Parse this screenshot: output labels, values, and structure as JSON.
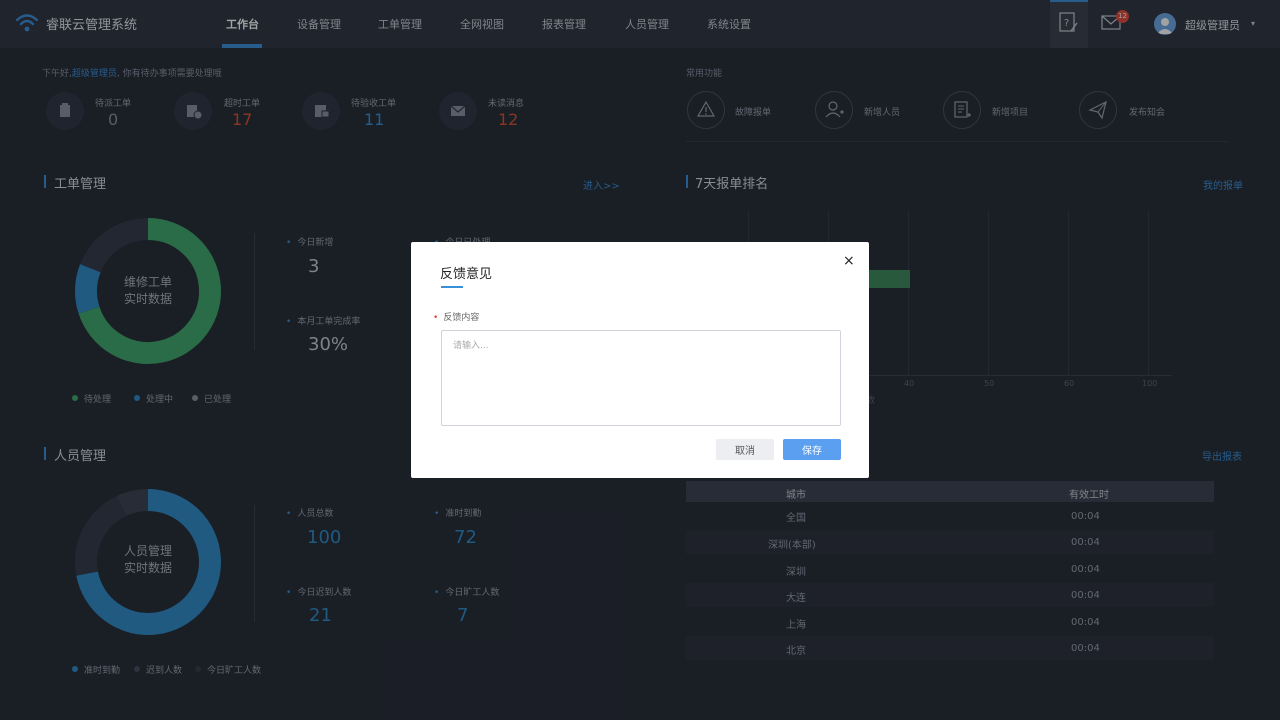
{
  "header": {
    "app_title": "睿联云管理系统",
    "nav": [
      "工作台",
      "设备管理",
      "工单管理",
      "全网视图",
      "报表管理",
      "人员管理",
      "系统设置"
    ],
    "active_nav": "工作台",
    "mail_badge": "12",
    "user_name": "超级管理员",
    "user_caret": "▾"
  },
  "greeting": {
    "prefix": "下午好,",
    "user": "超级管理员",
    "suffix": ", 你有待办事项需要处理哦"
  },
  "stats": [
    {
      "label": "待派工单",
      "value": "0",
      "color": "#9aa0ae",
      "icon": "clipboard-icon"
    },
    {
      "label": "超时工单",
      "value": "17",
      "color": "#d9532c",
      "icon": "overdue-icon"
    },
    {
      "label": "待验收工单",
      "value": "11",
      "color": "#3a8fd9",
      "icon": "inbox-icon"
    },
    {
      "label": "未读消息",
      "value": "12",
      "color": "#d9532c",
      "icon": "envelope-icon"
    }
  ],
  "common": {
    "title": "常用功能",
    "items": [
      {
        "label": "故障报单",
        "icon": "warning-icon"
      },
      {
        "label": "新增人员",
        "icon": "add-user-icon"
      },
      {
        "label": "新增项目",
        "icon": "add-project-icon"
      },
      {
        "label": "发布知会",
        "icon": "send-icon"
      }
    ]
  },
  "work_orders": {
    "title": "工单管理",
    "link": "进入>>",
    "donut_center": [
      "维修工单",
      "实时数据"
    ],
    "kpis": [
      {
        "label": "今日新增",
        "value": "3"
      },
      {
        "label": "今日已处理",
        "value": ""
      },
      {
        "label": "本月工单完成率",
        "value": "30%"
      }
    ],
    "legend": [
      {
        "label": "待处理",
        "color": "#3ea86b"
      },
      {
        "label": "处理中",
        "color": "#2f8bc9"
      },
      {
        "label": "已处理",
        "color": "#8a90a0"
      }
    ]
  },
  "ranking": {
    "title": "7天报单排名",
    "link": "我的报单",
    "xticks": [
      "40",
      "50",
      "60",
      "100"
    ],
    "xlabel": "数"
  },
  "personnel": {
    "title": "人员管理",
    "link": "导出报表",
    "donut_center": [
      "人员管理",
      "实时数据"
    ],
    "kpis": [
      {
        "label": "人员总数",
        "value": "100"
      },
      {
        "label": "准时到勤",
        "value": "72"
      },
      {
        "label": "今日迟到人数",
        "value": "21"
      },
      {
        "label": "今日旷工人数",
        "value": "7"
      }
    ],
    "legend": [
      {
        "label": "准时到勤",
        "color": "#2f8bc9"
      },
      {
        "label": "迟到人数",
        "color": "#454b5c"
      },
      {
        "label": "今日旷工人数",
        "color": "#353a48"
      }
    ]
  },
  "table": {
    "headers": [
      "城市",
      "有效工时"
    ],
    "rows": [
      [
        "全国",
        "00:04"
      ],
      [
        "深圳(本部)",
        "00:04"
      ],
      [
        "深圳",
        "00:04"
      ],
      [
        "大连",
        "00:04"
      ],
      [
        "上海",
        "00:04"
      ],
      [
        "北京",
        "00:04"
      ]
    ]
  },
  "dialog": {
    "title": "反馈意见",
    "close": "×",
    "required_mark": "•",
    "field_label": "反馈内容",
    "placeholder": "请输入...",
    "value": "",
    "cancel": "取消",
    "save": "保存"
  },
  "chart_data": [
    {
      "type": "pie",
      "title": "维修工单 实时数据",
      "labels": [
        "待处理",
        "处理中",
        "已处理"
      ],
      "values": [
        70,
        11,
        19
      ],
      "colors": [
        "#3ea86b",
        "#2f8bc9",
        "#343948"
      ]
    },
    {
      "type": "pie",
      "title": "人员管理 实时数据",
      "labels": [
        "准时到勤",
        "迟到人数",
        "今日旷工人数"
      ],
      "values": [
        72,
        21,
        7
      ],
      "colors": [
        "#2f8bc9",
        "#343948",
        "#3c4252"
      ]
    }
  ]
}
